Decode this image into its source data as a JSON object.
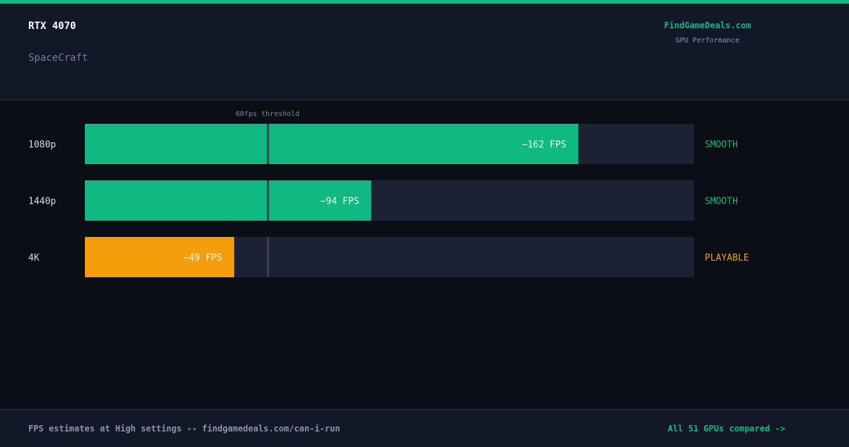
{
  "header": {
    "gpu": "RTX 4070",
    "game": "SpaceCraft",
    "brand": "FindGameDeals.com",
    "brand_sub": "GPU Performance"
  },
  "footer": {
    "note": "FPS estimates at High settings -- findgamedeals.com/can-i-run",
    "link": "All 51 GPUs compared ->"
  },
  "colors": {
    "smooth": "#10b981",
    "playable": "#f59e0b",
    "track": "#1c2234",
    "threshold": "#374155"
  },
  "chart_data": {
    "type": "bar",
    "orientation": "horizontal",
    "categories": [
      "1080p",
      "1440p",
      "4K"
    ],
    "values": [
      162,
      94,
      49
    ],
    "value_labels": [
      "~162 FPS",
      "~94 FPS",
      "~49 FPS"
    ],
    "statuses": [
      "SMOOTH",
      "SMOOTH",
      "PLAYABLE"
    ],
    "threshold": {
      "value": 60,
      "label": "60fps threshold"
    },
    "xlim": [
      0,
      200
    ]
  }
}
